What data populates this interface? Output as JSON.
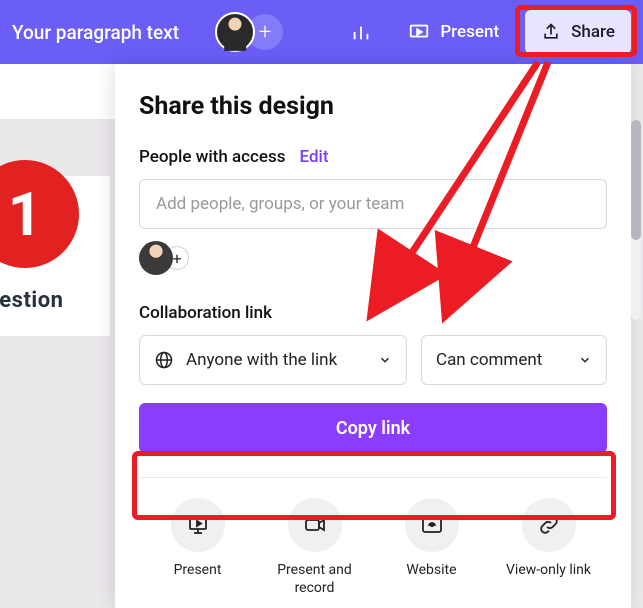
{
  "topbar": {
    "title": "Your paragraph text",
    "present_label": "Present",
    "share_label": "Share"
  },
  "preview": {
    "number": "1",
    "label": "uestion"
  },
  "share_panel": {
    "title": "Share this design",
    "access_label": "People with access",
    "edit_label": "Edit",
    "add_placeholder": "Add people, groups, or your team",
    "collab_label": "Collaboration link",
    "link_scope": "Anyone with the link",
    "permission": "Can comment",
    "copy_label": "Copy link",
    "actions": [
      {
        "label": "Present"
      },
      {
        "label": "Present and record"
      },
      {
        "label": "Website"
      },
      {
        "label": "View-only link"
      }
    ]
  }
}
